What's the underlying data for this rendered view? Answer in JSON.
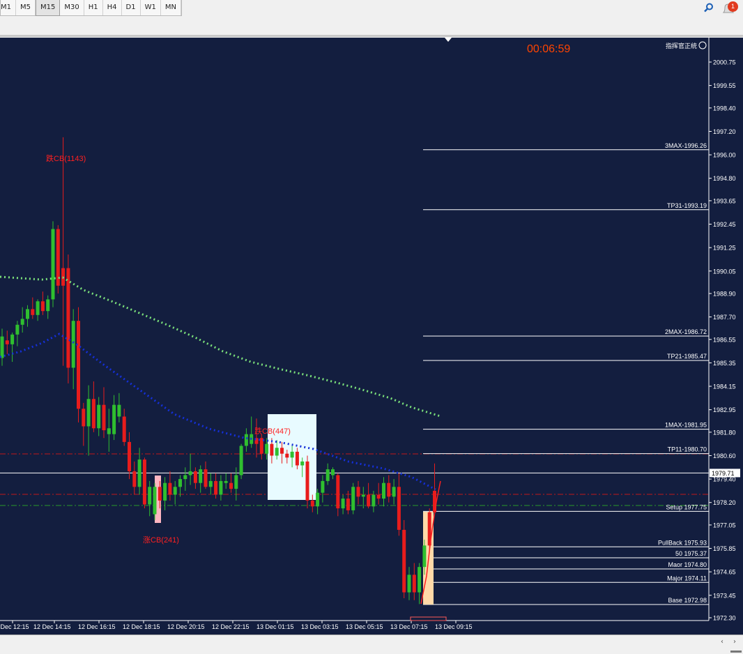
{
  "toolbar": {
    "timeframes": [
      "M1",
      "M5",
      "M15",
      "M30",
      "H1",
      "H4",
      "D1",
      "W1",
      "MN"
    ],
    "active_timeframe": "M15",
    "notification_count": "1"
  },
  "chart": {
    "countdown": "00:06:59",
    "indicator_label": "指挥官正统",
    "current_price": "1979.71",
    "colors": {
      "background": "#131e3f",
      "bull": "#2fbf2f",
      "bear": "#e81c1c",
      "text": "#ffffff",
      "countdown": "#ff4400",
      "ma_fast": "#1530d8",
      "ma_slow": "#7be07b",
      "annotation": "#ff2020"
    },
    "y_axis_ticks": [
      "2000.75",
      "1999.55",
      "1998.40",
      "1997.20",
      "1996.00",
      "1994.80",
      "1993.65",
      "1992.45",
      "1991.25",
      "1990.05",
      "1988.90",
      "1987.70",
      "1986.55",
      "1985.35",
      "1984.15",
      "1982.95",
      "1981.80",
      "1980.60",
      "1979.40",
      "1978.20",
      "1977.05",
      "1975.85",
      "1974.65",
      "1973.45",
      "1972.30"
    ],
    "x_axis_labels": [
      "12 Dec 12:15",
      "12 Dec 14:15",
      "12 Dec 16:15",
      "12 Dec 18:15",
      "12 Dec 20:15",
      "12 Dec 22:15",
      "13 Dec 01:15",
      "13 Dec 03:15",
      "13 Dec 05:15",
      "13 Dec 07:15",
      "13 Dec 09:15"
    ],
    "levels": [
      {
        "label": "3MAX-1996.26",
        "price": 1996.26
      },
      {
        "label": "TP31-1993.19",
        "price": 1993.19
      },
      {
        "label": "2MAX-1986.72",
        "price": 1986.72
      },
      {
        "label": "TP21-1985.47",
        "price": 1985.47
      },
      {
        "label": "1MAX-1981.95",
        "price": 1981.95
      },
      {
        "label": "TP11-1980.70",
        "price": 1980.7
      },
      {
        "label": "Setup 1977.75",
        "price": 1977.75
      },
      {
        "label": "PullBack 1975.93",
        "price": 1975.93
      },
      {
        "label": "50 1975.37",
        "price": 1975.37
      },
      {
        "label": "Maor 1974.80",
        "price": 1974.8
      },
      {
        "label": "Major 1974.11",
        "price": 1974.11
      },
      {
        "label": "Base 1972.98",
        "price": 1972.98
      }
    ],
    "annotations": [
      "跌CB(1143)",
      "跌CB(447)",
      "涨CB(241)"
    ]
  }
}
